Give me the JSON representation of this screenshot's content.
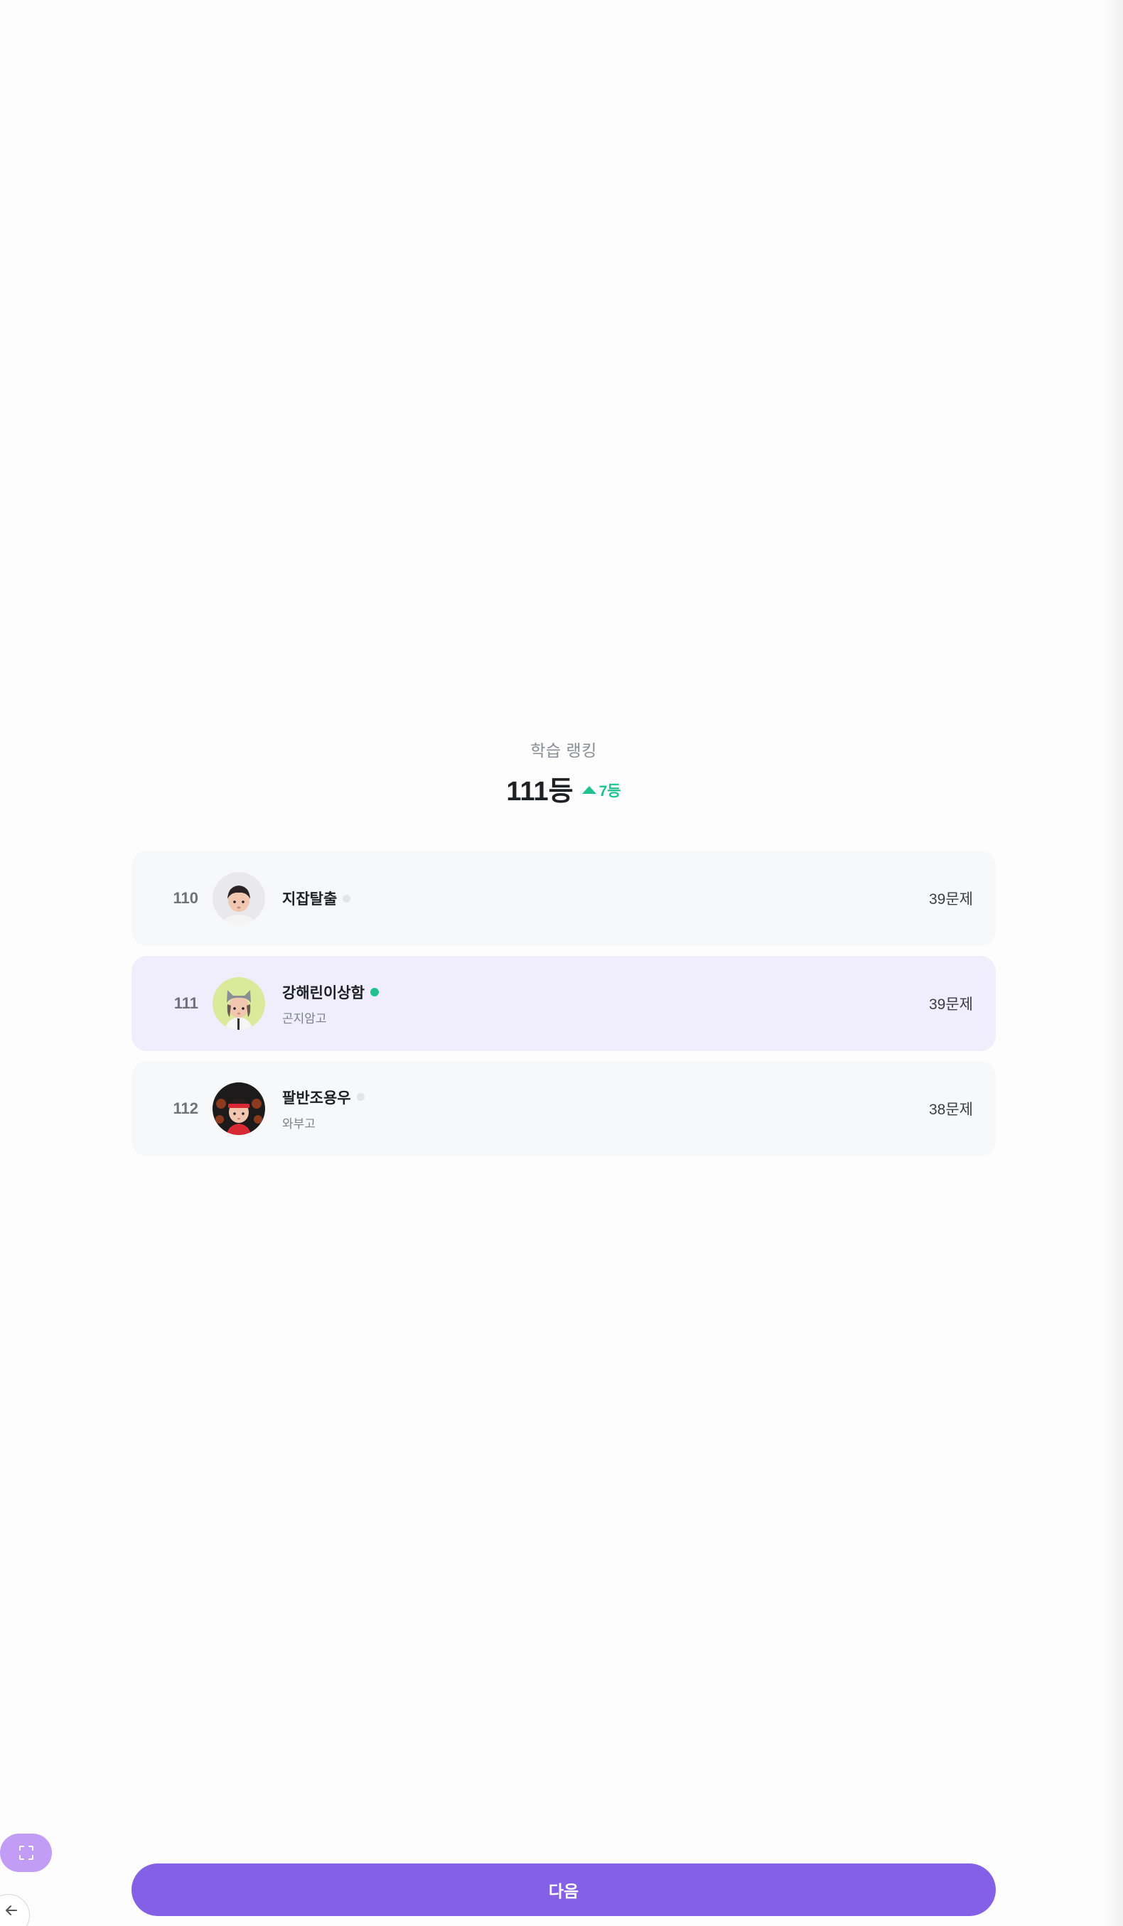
{
  "ranking": {
    "title": "학습 랭킹",
    "my_rank": "111등",
    "rank_change": "7등",
    "accent_color": "#1fc28f",
    "highlight_color": "#f0edfc",
    "rows": [
      {
        "rank": "110",
        "name": "지잡탈출",
        "school": "",
        "online": false,
        "solved": "39문제",
        "avatar": "boy-dark-hair-avatar",
        "me": false
      },
      {
        "rank": "111",
        "name": "강해린이상함",
        "school": "곤지암고",
        "online": true,
        "solved": "39문제",
        "avatar": "cat-ear-hat-avatar",
        "me": true
      },
      {
        "rank": "112",
        "name": "팔반조용우",
        "school": "와부고",
        "online": false,
        "solved": "38문제",
        "avatar": "red-headband-avatar",
        "me": false
      }
    ]
  },
  "footer": {
    "next_label": "다음",
    "primary_color": "#8460e6",
    "fullscreen_icon": "fullscreen-icon",
    "back_icon": "arrow-left-icon"
  }
}
